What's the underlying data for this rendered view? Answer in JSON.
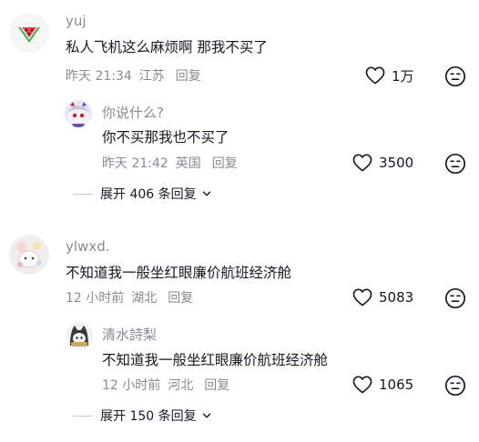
{
  "comments": [
    {
      "author": "yuj",
      "text": "私人飞机这么麻烦啊 那我不买了",
      "time": "昨天 21:34",
      "location": "江苏",
      "reply_label": "回复",
      "likes": "1万",
      "avatar_icon": "watermelon-icon",
      "reply": {
        "author": "你说什么?",
        "text": "你不买那我也不买了",
        "time": "昨天 21:42",
        "location": "英国",
        "reply_label": "回复",
        "likes": "3500",
        "avatar_icon": "anime-girl-avatar"
      },
      "expand_label": "展开 406 条回复"
    },
    {
      "author": "ylwxd.",
      "text": "不知道我一般坐红眼廉价航班经济舱",
      "time": "12 小时前",
      "location": "湖北",
      "reply_label": "回复",
      "likes": "5083",
      "avatar_icon": "cartoon-doodle-avatar",
      "reply": {
        "author": "清水詩梨",
        "text": "不知道我一般坐红眼廉价航班经济舱",
        "time": "12 小时前",
        "location": "河北",
        "reply_label": "回复",
        "likes": "1065",
        "avatar_icon": "hooded-cat-avatar"
      },
      "expand_label": "展开 150 条回复"
    }
  ],
  "colors": {
    "secondary_text": "#8a8b91",
    "primary_text": "#161823",
    "watermelon_red": "#f0404a",
    "watermelon_green": "#3fae49"
  }
}
